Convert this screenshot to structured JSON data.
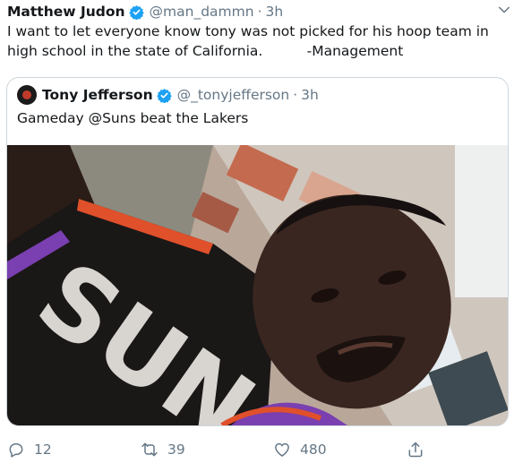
{
  "tweet": {
    "author_name": "Matthew Judon",
    "handle": "@man_dammn",
    "time": "3h",
    "text": "I want to let everyone know tony was not picked for his hoop team in high school in the state of California.          -Management"
  },
  "quoted": {
    "author_name": "Tony Jefferson",
    "handle": "@_tonyjefferson",
    "time": "3h",
    "text": "Gameday @Suns beat the Lakers",
    "photo": "selfie-in-suns-jersey-over-city"
  },
  "actions": {
    "reply_count": "12",
    "retweet_count": "39",
    "like_count": "480"
  },
  "colors": {
    "verified": "#1da1f2",
    "muted": "#657786",
    "border": "#ccd6dd"
  }
}
